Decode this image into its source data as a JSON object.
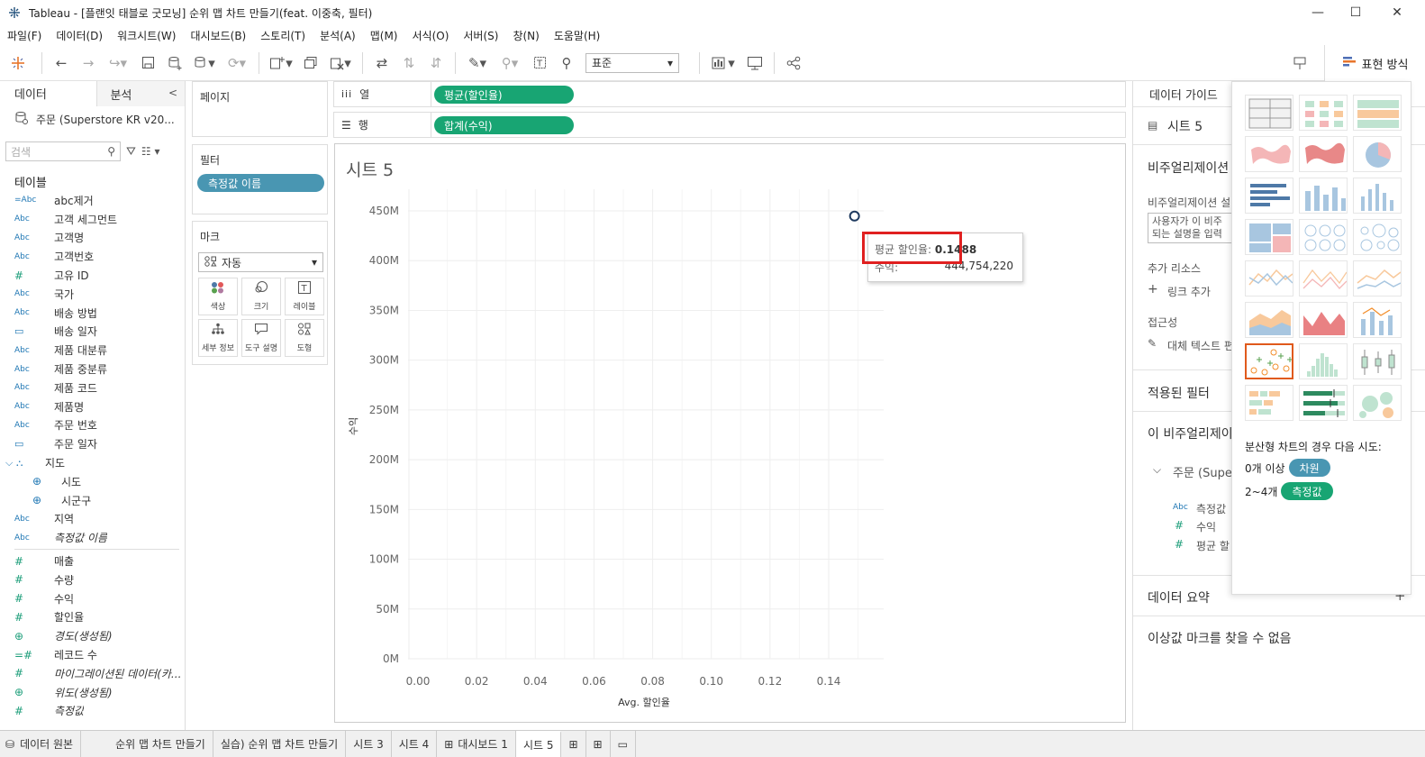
{
  "window": {
    "title": "Tableau - [플랜잇 태블로 굿모닝] 순위 맵 차트 만들기(feat. 이중축, 필터)",
    "minimize": "—",
    "maximize": "☐",
    "close": "✕"
  },
  "menu": [
    "파일(F)",
    "데이터(D)",
    "워크시트(W)",
    "대시보드(B)",
    "스토리(T)",
    "분석(A)",
    "맵(M)",
    "서식(O)",
    "서버(S)",
    "창(N)",
    "도움말(H)"
  ],
  "toolbar": {
    "fit_select": "표준",
    "showme_label": "표현 방식"
  },
  "data_pane": {
    "tab_data": "데이터",
    "tab_analysis": "분석",
    "collapse": "<",
    "source": "주문 (Superstore KR v20...",
    "search_placeholder": "검색",
    "tables_header": "테이블",
    "fields": [
      {
        "type": "=Abc",
        "name": "abc제거",
        "kind": "dim"
      },
      {
        "type": "Abc",
        "name": "고객 세그먼트",
        "kind": "dim"
      },
      {
        "type": "Abc",
        "name": "고객명",
        "kind": "dim"
      },
      {
        "type": "Abc",
        "name": "고객번호",
        "kind": "dim"
      },
      {
        "type": "#",
        "name": "고유 ID",
        "kind": "dimnum"
      },
      {
        "type": "Abc",
        "name": "국가",
        "kind": "dim"
      },
      {
        "type": "Abc",
        "name": "배송 방법",
        "kind": "dim"
      },
      {
        "type": "▭",
        "name": "배송 일자",
        "kind": "dim"
      },
      {
        "type": "Abc",
        "name": "제품 대분류",
        "kind": "dim"
      },
      {
        "type": "Abc",
        "name": "제품 중분류",
        "kind": "dim"
      },
      {
        "type": "Abc",
        "name": "제품 코드",
        "kind": "dim"
      },
      {
        "type": "Abc",
        "name": "제품명",
        "kind": "dim"
      },
      {
        "type": "Abc",
        "name": "주문 번호",
        "kind": "dim"
      },
      {
        "type": "▭",
        "name": "주문 일자",
        "kind": "dim"
      },
      {
        "type": "⌵ ⛬",
        "name": "지도",
        "kind": "hier"
      },
      {
        "type": "⊕",
        "name": "시도",
        "kind": "geo"
      },
      {
        "type": "⊕",
        "name": "시군구",
        "kind": "geo"
      },
      {
        "type": "Abc",
        "name": "지역",
        "kind": "dim"
      },
      {
        "type": "Abc",
        "name": "측정값 이름",
        "kind": "dimitalic"
      }
    ],
    "measures": [
      {
        "type": "#",
        "name": "매출",
        "kind": "measure"
      },
      {
        "type": "#",
        "name": "수량",
        "kind": "measure"
      },
      {
        "type": "#",
        "name": "수익",
        "kind": "measure"
      },
      {
        "type": "#",
        "name": "할인율",
        "kind": "measure"
      },
      {
        "type": "⊕",
        "name": "경도(생성됨)",
        "kind": "measureitalic"
      },
      {
        "type": "=#",
        "name": "레코드 수",
        "kind": "measure"
      },
      {
        "type": "#",
        "name": "마이그레이션된 데이터(카...",
        "kind": "measureitalic"
      },
      {
        "type": "⊕",
        "name": "위도(생성됨)",
        "kind": "measureitalic"
      },
      {
        "type": "#",
        "name": "측정값",
        "kind": "measureitalic"
      }
    ]
  },
  "cards": {
    "pages": "페이지",
    "filters": "필터",
    "filter_pill": "측정값 이름",
    "marks": "마크",
    "marks_type": "자동",
    "mark_buttons": [
      "색상",
      "크기",
      "레이블",
      "세부 정보",
      "도구 설명",
      "도형"
    ]
  },
  "shelves": {
    "columns_label": "열",
    "columns_pill": "평균(할인율)",
    "rows_label": "행",
    "rows_pill": "합계(수익)"
  },
  "sheet": {
    "title": "시트 5"
  },
  "chart_data": {
    "type": "scatter",
    "x": [
      0.1488
    ],
    "y": [
      444754220
    ],
    "xlabel": "Avg. 할인율",
    "ylabel": "수익",
    "xlim": [
      0.0,
      0.155
    ],
    "ylim": [
      0,
      450000000
    ],
    "x_ticks": [
      "0.00",
      "0.02",
      "0.04",
      "0.06",
      "0.08",
      "0.10",
      "0.12",
      "0.14"
    ],
    "x_tick_values": [
      0,
      0.02,
      0.04,
      0.06,
      0.08,
      0.1,
      0.12,
      0.14
    ],
    "y_ticks": [
      "0M",
      "50M",
      "100M",
      "150M",
      "200M",
      "250M",
      "300M",
      "350M",
      "400M",
      "450M"
    ],
    "y_tick_values": [
      0,
      50000000,
      100000000,
      150000000,
      200000000,
      250000000,
      300000000,
      350000000,
      400000000,
      450000000
    ],
    "grid": true,
    "mark_color": "#1f3a5f"
  },
  "tooltip": {
    "key1": "평균 할인율:",
    "val1": "0.1488",
    "key2": "수익:",
    "val2": "444,754,220"
  },
  "data_guide": {
    "tab": "데이터 가이드",
    "sheet_name": "시트 5",
    "viz_section": "비주얼리제이션",
    "viz_desc_label": "비주얼리제이션 설",
    "viz_desc_input": "사용자가 이 비주\n되는 설명을 입력",
    "resources": "추가 리소스",
    "add_link": "링크 추가",
    "accessibility": "접근성",
    "alt_text": "대체 텍스트 편",
    "applied_filters": "적용된 필터",
    "in_viz": "이 비주얼리제이",
    "source_item": "주문 (Supe",
    "field1": "측정값 ",
    "field2": "수익",
    "field3": "평균 할",
    "data_summary": "데이터 요약",
    "outliers": "이상값 마크를 찾을 수 없음"
  },
  "showme": {
    "hint": "분산형 차트의 경우 다음 시도:",
    "req1_prefix": "0개 이상",
    "req1_pill": "차원",
    "req2_prefix": "2~4개",
    "req2_pill": "측정값",
    "dim_color": "#4996b2",
    "measure_color": "#18a573"
  },
  "tabs": {
    "datasource": "데이터 원본",
    "sheets": [
      "순위 맵 차트 만들기",
      "실습) 순위 맵 차트 만들기",
      "시트 3",
      "시트 4",
      "대시보드 1",
      "시트 5"
    ]
  }
}
